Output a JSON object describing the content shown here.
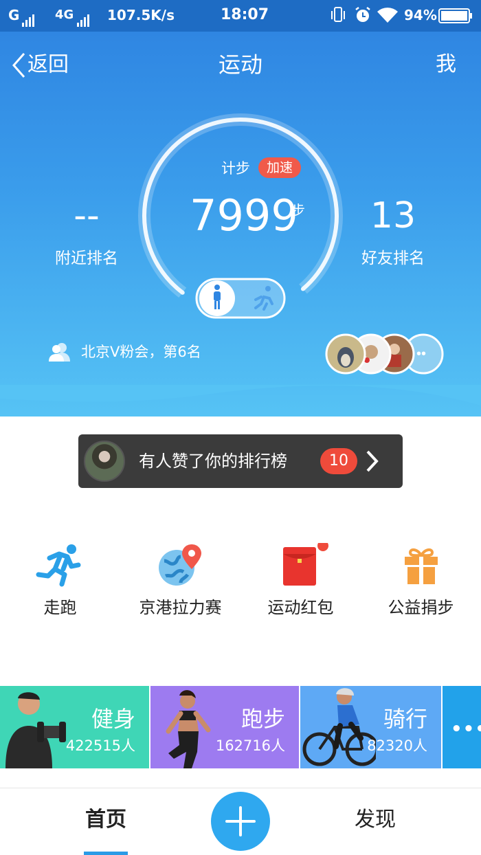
{
  "status_bar": {
    "left_text": "G",
    "network": "4G",
    "speed": "107.5K/s",
    "time": "18:07",
    "battery": "94%"
  },
  "nav": {
    "back_label": "返回",
    "title": "运动",
    "me_label": "我"
  },
  "steps": {
    "label": "计步",
    "boost_label": "加速",
    "count": "7999",
    "unit": "步",
    "nearby_value": "--",
    "nearby_label": "附近排名",
    "friend_value": "13",
    "friend_label": "好友排名",
    "group_text": "北京V粉会，第6名"
  },
  "notice": {
    "text": "有人赞了你的排行榜",
    "badge": "10"
  },
  "features": [
    {
      "label": "走跑",
      "icon": "runner-icon"
    },
    {
      "label": "京港拉力赛",
      "icon": "globe-pin-icon"
    },
    {
      "label": "运动红包",
      "icon": "red-envelope-icon"
    },
    {
      "label": "公益捐步",
      "icon": "gift-icon"
    }
  ],
  "categories": [
    {
      "name": "健身",
      "count": "422515人",
      "color": "#3fd6b6"
    },
    {
      "name": "跑步",
      "count": "162716人",
      "color": "#9d7bf0"
    },
    {
      "name": "骑行",
      "count": "82320人",
      "color": "#5ea9f5"
    }
  ],
  "more_label": "•••",
  "tabs": {
    "home": "首页",
    "discover": "发现"
  },
  "colors": {
    "accent": "#2fa8ef",
    "badge_red": "#ef4b3b",
    "header_top": "#2f86e2"
  }
}
